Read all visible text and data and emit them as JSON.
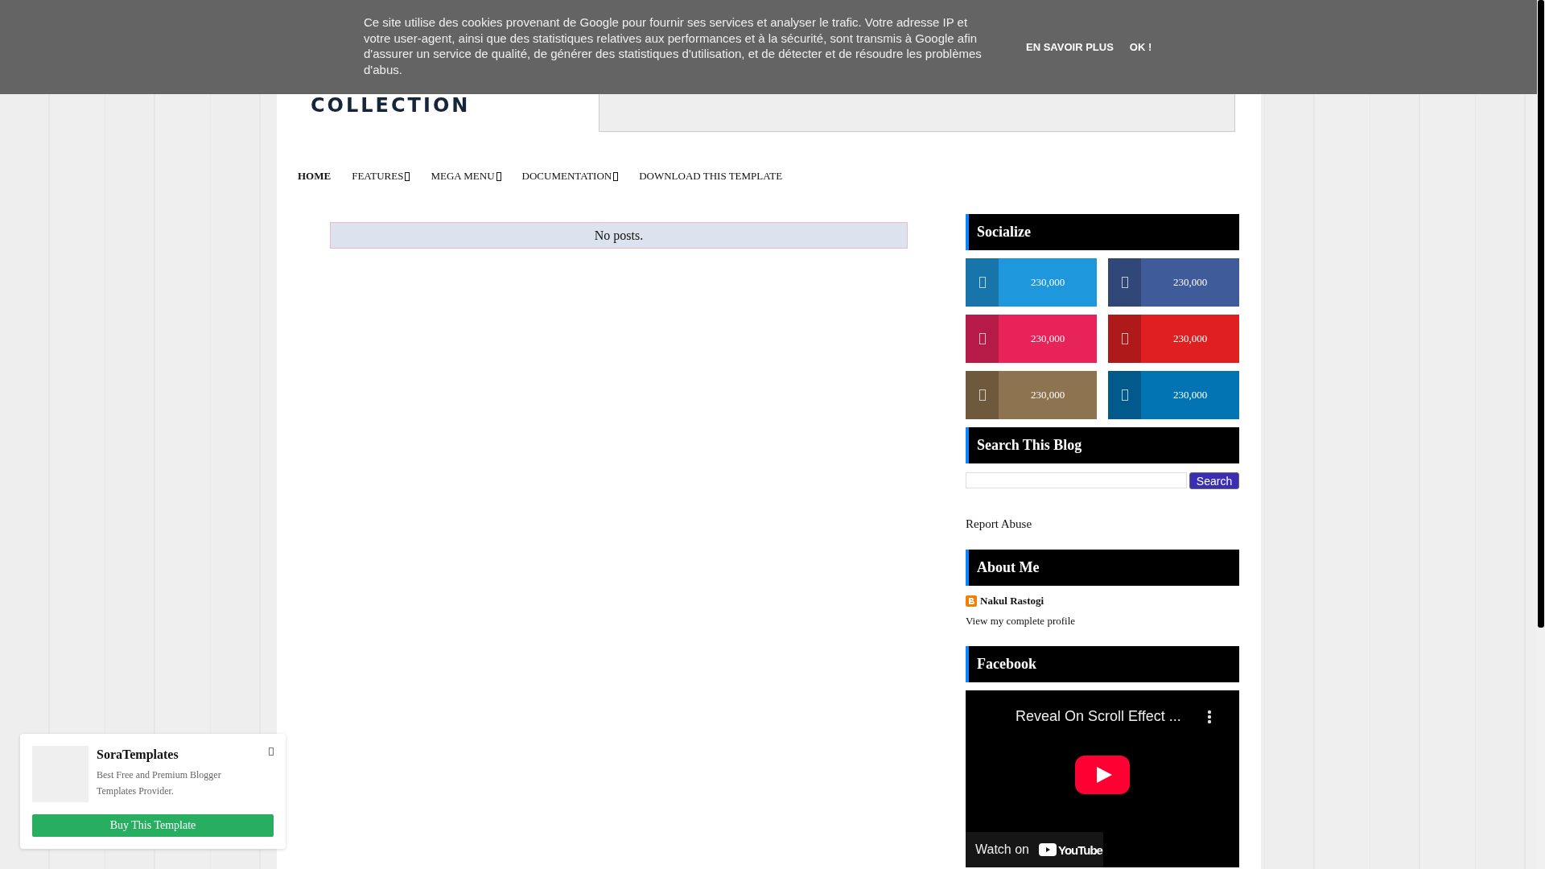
{
  "cookie_bar": {
    "text": "Ce site utilise des cookies provenant de Google pour fournir ses services et analyser le trafic. Votre adresse IP et votre user-agent, ainsi que des statistiques relatives aux performances et à la sécurité, sont transmis à Google afin d'assurer un service de qualité, de générer des statistiques d'utilisation, et de détecter et de résoudre les problèmes d'abus.",
    "links": [
      "EN SAVOIR PLUS",
      "OK !"
    ]
  },
  "logo": {
    "text": "COLLECTION"
  },
  "nav": [
    {
      "label": "HOME",
      "dropdown": false
    },
    {
      "label": "FEATURES",
      "dropdown": true
    },
    {
      "label": "MEGA MENU",
      "dropdown": true
    },
    {
      "label": "DOCUMENTATION",
      "dropdown": true
    },
    {
      "label": "DOWNLOAD THIS TEMPLATE",
      "dropdown": false
    }
  ],
  "main": {
    "message": "No posts."
  },
  "sidebar": {
    "socialize": {
      "title": "Socialize",
      "items": [
        {
          "count": "230,000",
          "color": "#1e97dc"
        },
        {
          "count": "230,000",
          "color": "#3f5b9a"
        },
        {
          "count": "230,000",
          "color": "#e8235a"
        },
        {
          "count": "230,000",
          "color": "#e02020"
        },
        {
          "count": "230,000",
          "color": "#8d734f"
        },
        {
          "count": "230,000",
          "color": "#0274b3"
        }
      ]
    },
    "search": {
      "title": "Search This Blog",
      "button": "Search"
    },
    "report_abuse": "Report Abuse",
    "about": {
      "title": "About Me",
      "name": "Nakul Rastogi",
      "link": "View my complete profile"
    },
    "facebook": {
      "title": "Facebook",
      "video_title": "Reveal On Scroll Effect ...",
      "watch_on": "Watch on",
      "brand": "YouTube"
    }
  },
  "popup": {
    "title": "SoraTemplates",
    "text": "Best Free and Premium Blogger Templates Provider.",
    "button": "Buy This Template"
  }
}
